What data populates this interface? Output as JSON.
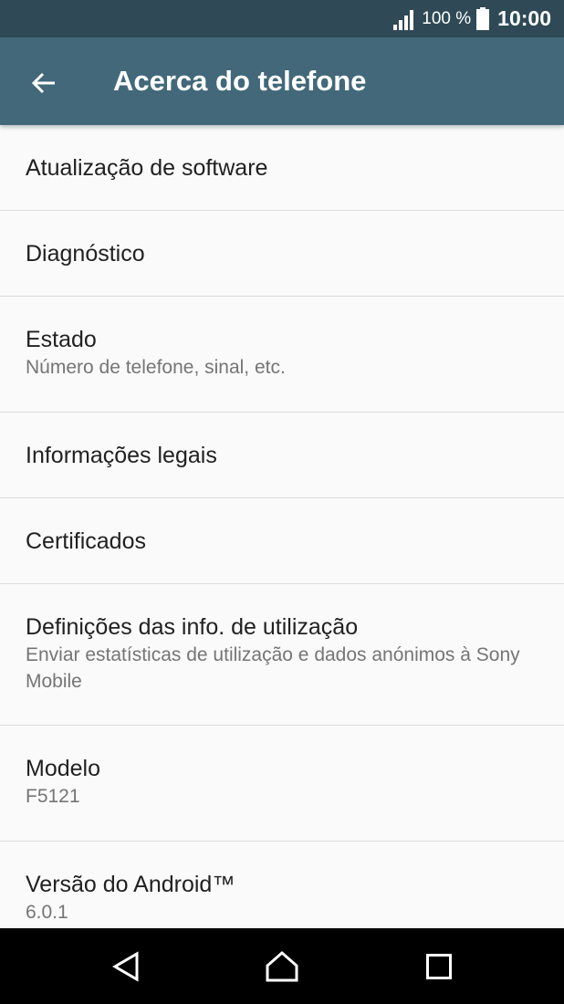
{
  "status_bar": {
    "battery_percent": "100 %",
    "time": "10:00",
    "icons": [
      "signal-icon",
      "battery-icon"
    ]
  },
  "app_bar": {
    "title": "Acerca do telefone",
    "back_icon": "arrow-back-icon"
  },
  "items": [
    {
      "title": "Atualização de software",
      "summary": ""
    },
    {
      "title": "Diagnóstico",
      "summary": ""
    },
    {
      "title": "Estado",
      "summary": "Número de telefone, sinal, etc."
    },
    {
      "title": "Informações legais",
      "summary": ""
    },
    {
      "title": "Certificados",
      "summary": ""
    },
    {
      "title": "Definições das info. de utilização",
      "summary": "Enviar estatísticas de utilização e dados anónimos à Sony Mobile"
    },
    {
      "title": "Modelo",
      "summary": "F5121"
    },
    {
      "title": "Versão do Android™",
      "summary": "6.0.1"
    }
  ],
  "nav_bar": {
    "icons": [
      "back-triangle-icon",
      "home-icon",
      "recents-square-icon"
    ]
  },
  "colors": {
    "status_bar": "#2f4a56",
    "app_bar": "#42687a",
    "background": "#fafafa",
    "divider": "#dcdcdc",
    "primary_text": "#212121",
    "secondary_text": "#757575"
  }
}
